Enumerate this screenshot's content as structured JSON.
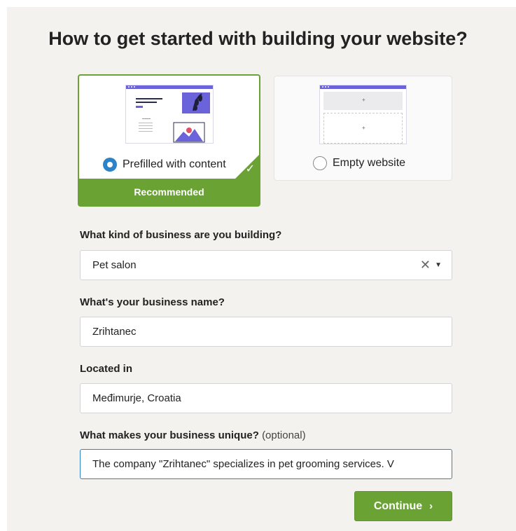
{
  "title": "How to get started with building your website?",
  "options": {
    "prefilled": {
      "label": "Prefilled with content",
      "selected": true,
      "badge": "Recommended"
    },
    "empty": {
      "label": "Empty website",
      "selected": false
    }
  },
  "form": {
    "business_kind": {
      "label": "What kind of business are you building?",
      "value": "Pet salon"
    },
    "business_name": {
      "label": "What's your business name?",
      "value": "Zrihtanec"
    },
    "location": {
      "label": "Located in",
      "value": "Međimurje, Croatia"
    },
    "unique": {
      "label": "What makes your business unique?",
      "optional": "(optional)",
      "value": "The company \"Zrihtanec\" specializes in pet grooming services. V"
    }
  },
  "continue_label": "Continue",
  "colors": {
    "accent_green": "#6aa334",
    "radio_blue": "#2d83c7",
    "preview_purple": "#6a63d9"
  }
}
